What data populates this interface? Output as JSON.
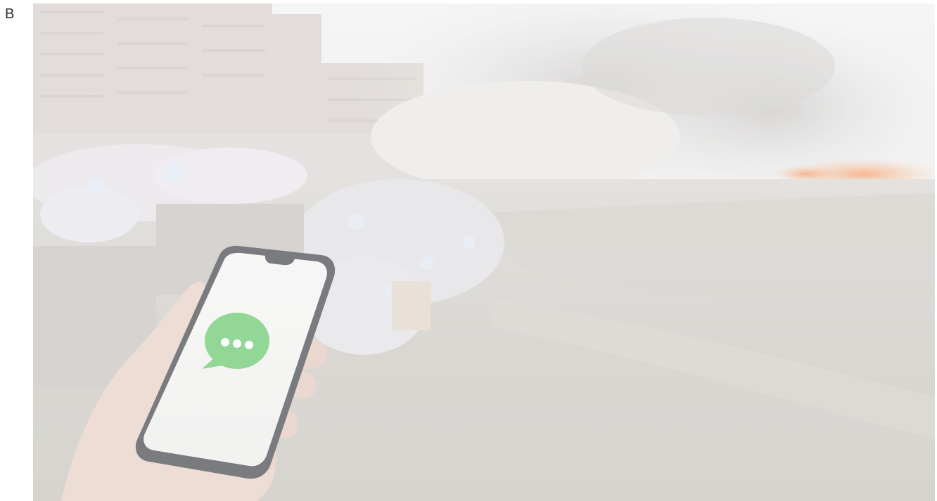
{
  "figure": {
    "panel_label": "B"
  },
  "photo": {
    "icon": "chat-bubble-icon",
    "colors": {
      "haze": "#f4f4f2",
      "ground": "#cfccc6",
      "smoke": "#d8d6d3",
      "fire": "#f2b48a",
      "chat_bubble": "#7ccf7f",
      "phone_frame": "#5d5f63",
      "phone_screen": "#f3f3f1",
      "skin": "#ead6cc"
    }
  }
}
